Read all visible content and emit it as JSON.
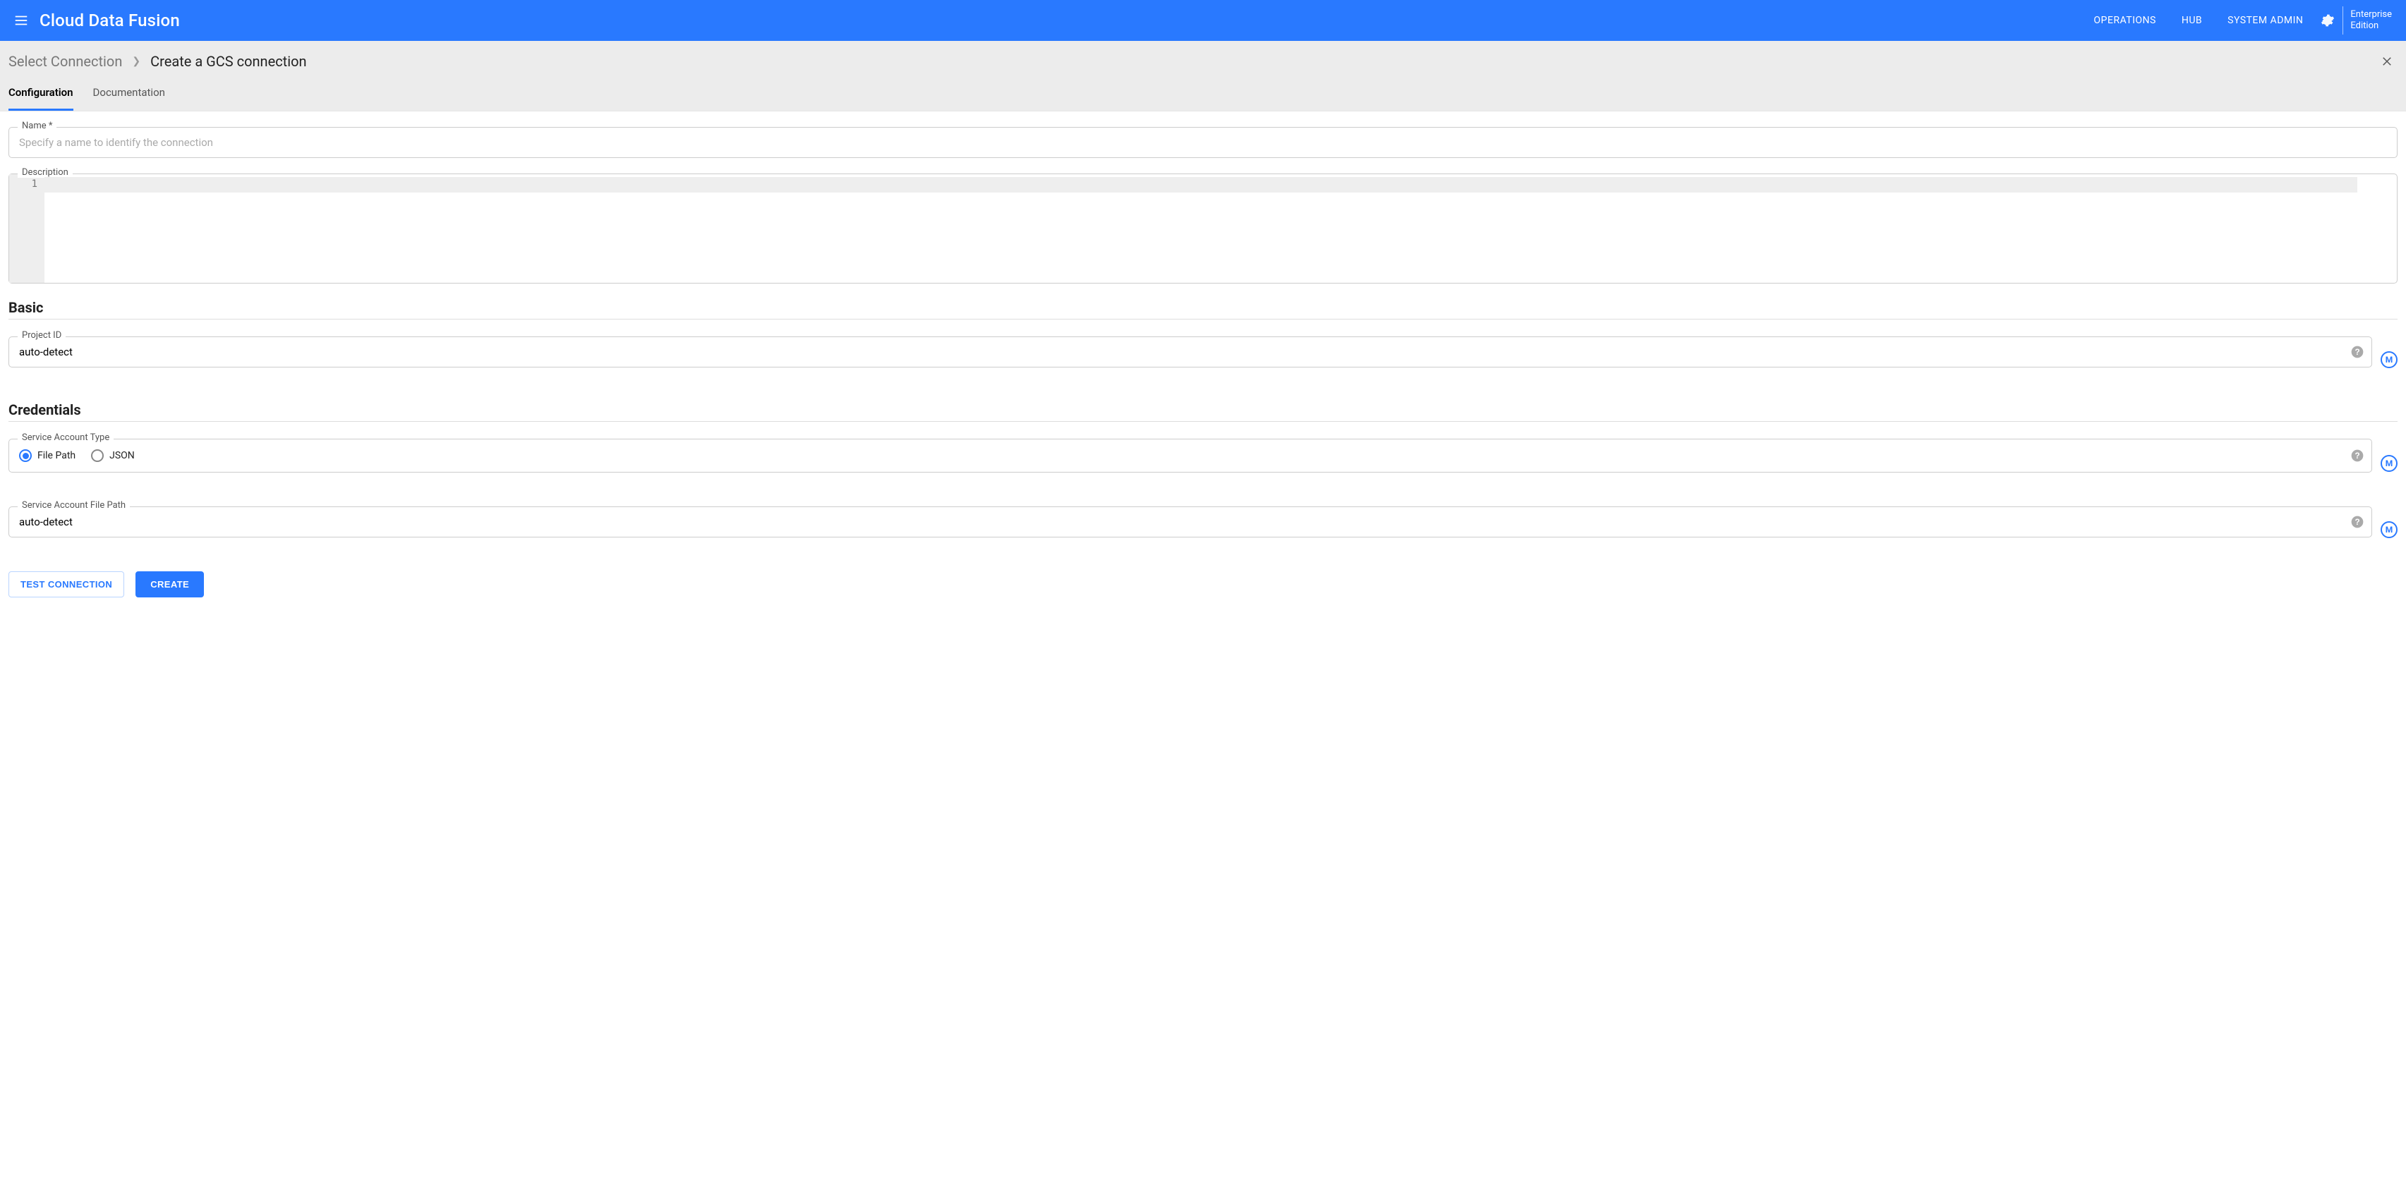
{
  "header": {
    "brand": "Cloud Data Fusion",
    "nav": [
      "OPERATIONS",
      "HUB",
      "SYSTEM ADMIN"
    ],
    "edition_line1": "Enterprise",
    "edition_line2": "Edition"
  },
  "breadcrumb": {
    "back": "Select Connection",
    "current": "Create a GCS connection"
  },
  "tabs": {
    "configuration": "Configuration",
    "documentation": "Documentation"
  },
  "fields": {
    "name_label": "Name",
    "name_placeholder": "Specify a name to identify the connection",
    "name_value": "",
    "description_label": "Description",
    "description_value": "",
    "gutter_line": "1"
  },
  "sections": {
    "basic": "Basic",
    "credentials": "Credentials"
  },
  "project_id": {
    "label": "Project ID",
    "value": "auto-detect"
  },
  "sa_type": {
    "label": "Service Account Type",
    "opt_filepath": "File Path",
    "opt_json": "JSON"
  },
  "sa_filepath": {
    "label": "Service Account File Path",
    "value": "auto-detect"
  },
  "buttons": {
    "test": "TEST CONNECTION",
    "create": "CREATE"
  },
  "badge_m": "M"
}
